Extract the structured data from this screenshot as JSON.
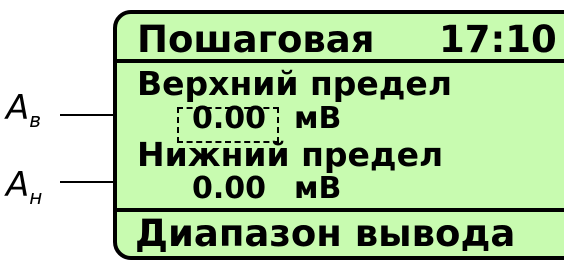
{
  "screen": {
    "title": "Пошаговая",
    "time": "17:10",
    "upper_limit": {
      "label": "Верхний предел",
      "value": "0.00",
      "unit": "мВ"
    },
    "lower_limit": {
      "label": "Нижний предел",
      "value": "0.00",
      "unit": "мВ"
    },
    "footer": "Диапазон вывода"
  },
  "callouts": {
    "upper": {
      "symbol": "A",
      "subscript": "в"
    },
    "lower": {
      "symbol": "A",
      "subscript": "н"
    }
  },
  "colors": {
    "lcd_background": "#c8fbb0",
    "foreground": "#000000"
  }
}
